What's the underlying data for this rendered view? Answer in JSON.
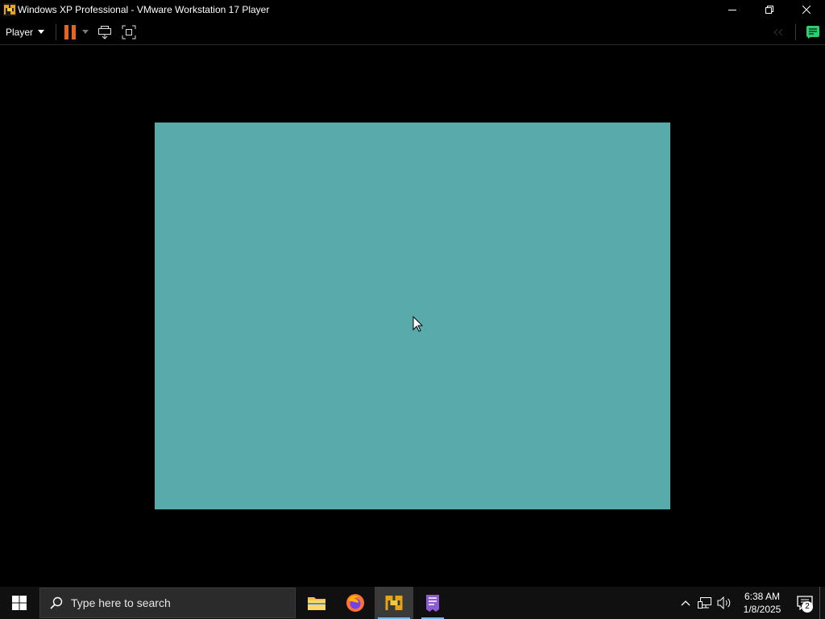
{
  "window": {
    "title": "Windows XP Professional - VMware Workstation 17 Player",
    "controls": {
      "minimize": "minimize-icon",
      "restore": "restore-icon",
      "close": "close-icon"
    }
  },
  "toolbar": {
    "player_menu_label": "Player",
    "buttons": [
      "pause-icon",
      "send-ctrl-alt-del-icon",
      "fullscreen-icon"
    ],
    "right": [
      "back-disabled-icon",
      "library-notes-icon"
    ],
    "colors": {
      "pause": "#e8641b",
      "notes": "#2ecc71"
    }
  },
  "vm": {
    "screen_color": "#59aaaa",
    "cursor": "pointer-cursor-icon"
  },
  "taskbar": {
    "search_placeholder": "Type here to search",
    "apps": [
      {
        "name": "File Explorer",
        "icon": "folder-icon"
      },
      {
        "name": "Firefox",
        "icon": "firefox-icon"
      },
      {
        "name": "VMware Workstation Player",
        "icon": "vmware-icon",
        "active": true
      },
      {
        "name": "App",
        "icon": "app-icon"
      }
    ],
    "clock": {
      "time": "6:38 AM",
      "date": "1/8/2025"
    },
    "notifications_count": "2"
  }
}
